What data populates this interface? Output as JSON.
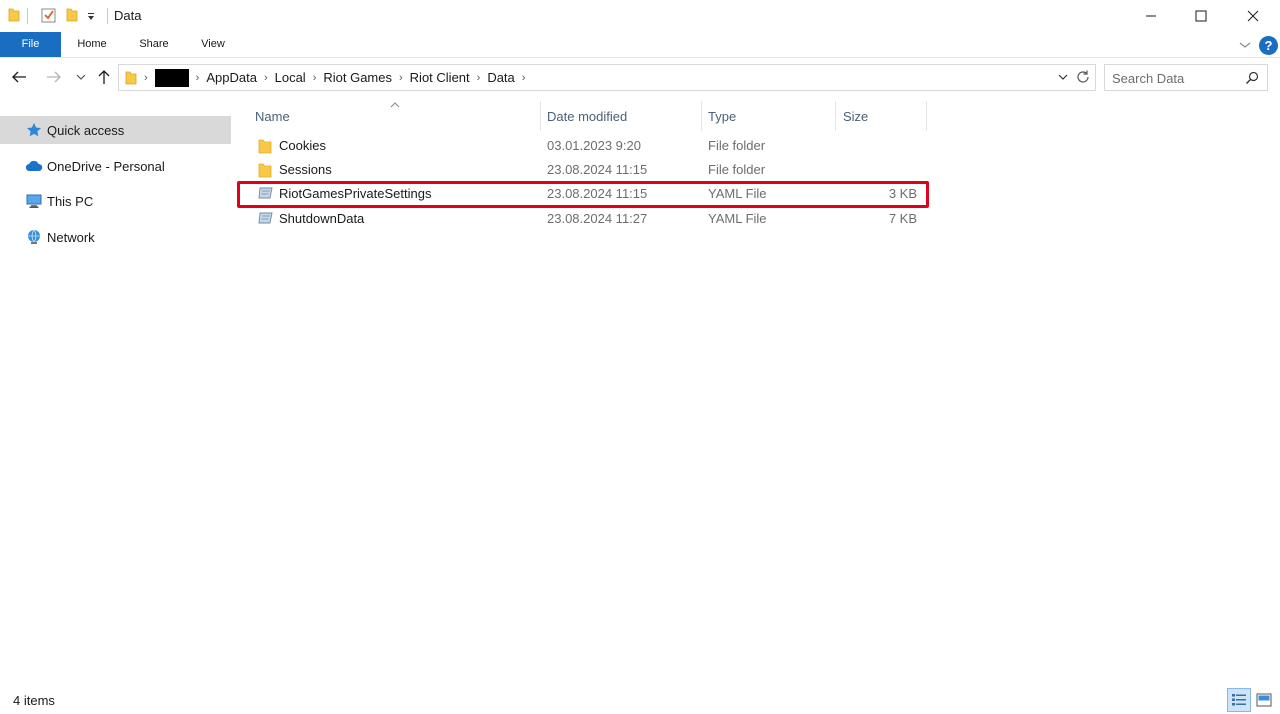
{
  "window": {
    "title": "Data",
    "controls": {
      "minimize": "minimize-icon",
      "maximize": "maximize-icon",
      "close": "close-icon"
    }
  },
  "ribbon": {
    "tabs": [
      {
        "label": "File"
      },
      {
        "label": "Home"
      },
      {
        "label": "Share"
      },
      {
        "label": "View"
      }
    ],
    "help_label": "?"
  },
  "address": {
    "crumbs": [
      "AppData",
      "Local",
      "Riot Games",
      "Riot Client",
      "Data"
    ]
  },
  "search": {
    "placeholder": "Search Data"
  },
  "sidebar": {
    "items": [
      {
        "label": "Quick access",
        "icon": "star-icon",
        "selected": true
      },
      {
        "label": "OneDrive - Personal",
        "icon": "cloud-icon"
      },
      {
        "label": "This PC",
        "icon": "computer-icon"
      },
      {
        "label": "Network",
        "icon": "network-icon"
      }
    ]
  },
  "columns": {
    "name": "Name",
    "date": "Date modified",
    "type": "Type",
    "size": "Size"
  },
  "files": [
    {
      "name": "Cookies",
      "date": "03.01.2023 9:20",
      "type": "File folder",
      "size": "",
      "icon": "folder-icon"
    },
    {
      "name": "Sessions",
      "date": "23.08.2024 11:15",
      "type": "File folder",
      "size": "",
      "icon": "folder-icon"
    },
    {
      "name": "RiotGamesPrivateSettings",
      "date": "23.08.2024 11:15",
      "type": "YAML File",
      "size": "3 KB",
      "icon": "yaml-file-icon",
      "highlighted": true
    },
    {
      "name": "ShutdownData",
      "date": "23.08.2024 11:27",
      "type": "YAML File",
      "size": "7 KB",
      "icon": "yaml-file-icon"
    }
  ],
  "status": {
    "item_count": "4 items"
  },
  "colors": {
    "accent": "#1a6ec2",
    "highlight_border": "#e0001b",
    "folder": "#f8c846",
    "selected_nav": "#d9d9d9"
  }
}
